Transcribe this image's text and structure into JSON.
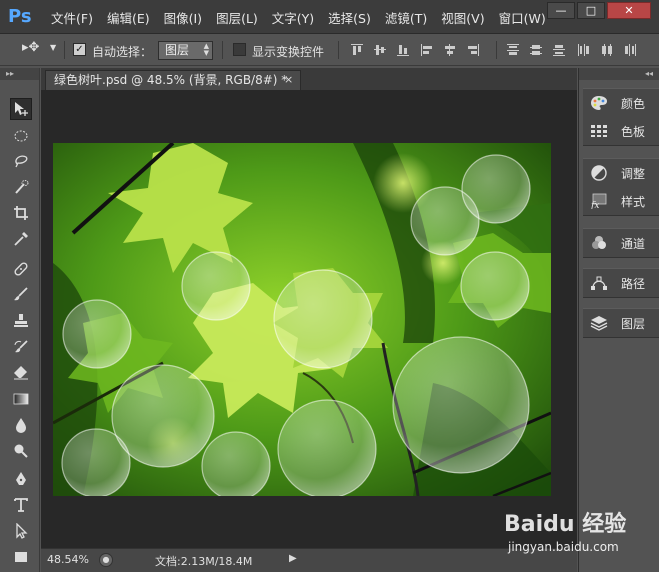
{
  "app": {
    "logo": "Ps",
    "window_controls": {
      "minimize": "—",
      "maximize": "□",
      "close": "✕"
    }
  },
  "menu": [
    "文件(F)",
    "编辑(E)",
    "图像(I)",
    "图层(L)",
    "文字(Y)",
    "选择(S)",
    "滤镜(T)",
    "视图(V)",
    "窗口(W)"
  ],
  "options": {
    "tool_icon": "move-tool-icon",
    "tool_glyph": "▸✥",
    "auto_select_label": "自动选择：",
    "auto_select_checked": true,
    "auto_select_target": "图层",
    "show_transform_label": "显示变换控件",
    "show_transform_checked": false
  },
  "document": {
    "tab_title": "绿色树叶.psd @ 48.5% (背景, RGB/8#) *",
    "close_glyph": "×"
  },
  "status": {
    "zoom": "48.54%",
    "doc_size": "文档:2.13M/18.4M",
    "arrow": "▶"
  },
  "panels": [
    {
      "group": [
        {
          "label": "颜色",
          "icon": "color-palette-icon"
        },
        {
          "label": "色板",
          "icon": "swatches-icon"
        }
      ]
    },
    {
      "group": [
        {
          "label": "调整",
          "icon": "adjustments-icon"
        },
        {
          "label": "样式",
          "icon": "styles-fx-icon"
        }
      ]
    },
    {
      "group": [
        {
          "label": "通道",
          "icon": "channels-icon"
        }
      ]
    },
    {
      "group": [
        {
          "label": "路径",
          "icon": "paths-icon"
        }
      ]
    },
    {
      "group": [
        {
          "label": "图层",
          "icon": "layers-icon"
        }
      ]
    }
  ],
  "watermark": {
    "logo": "Baidu 经验",
    "url": "jingyan.baidu.com"
  },
  "colors": {
    "accent_blue": "#56a8ff",
    "close_red": "#b84646",
    "ui_dark": "#3c3c3c",
    "ui_mid": "#535353"
  }
}
